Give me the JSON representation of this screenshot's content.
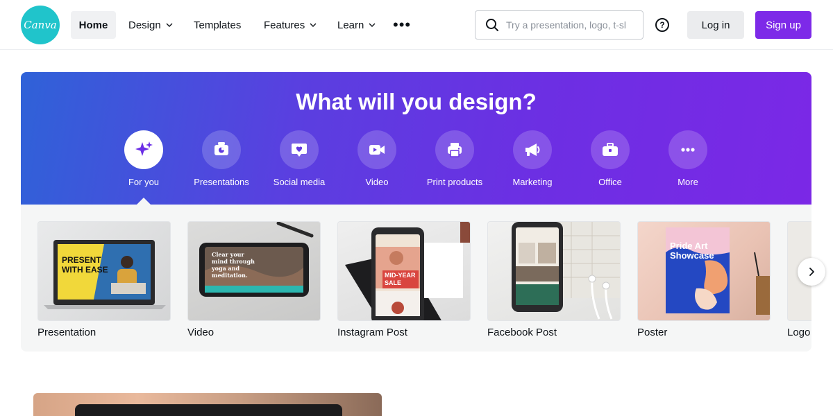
{
  "app": {
    "logo_text": "Canva",
    "brand_color": "#7d2ae8",
    "logo_color": "#20c4cb"
  },
  "nav": {
    "items": [
      {
        "label": "Home",
        "has_dropdown": false,
        "active": true
      },
      {
        "label": "Design",
        "has_dropdown": true
      },
      {
        "label": "Templates",
        "has_dropdown": false
      },
      {
        "label": "Features",
        "has_dropdown": true
      },
      {
        "label": "Learn",
        "has_dropdown": true
      }
    ],
    "more_icon": "more-horizontal-icon"
  },
  "search": {
    "placeholder": "Try a presentation, logo, t-sl",
    "icon": "search-icon"
  },
  "help_icon": "help-circle-icon",
  "auth": {
    "login_label": "Log in",
    "signup_label": "Sign up"
  },
  "hero": {
    "title": "What will you design?",
    "categories": [
      {
        "label": "For you",
        "icon": "sparkle-icon",
        "active": true
      },
      {
        "label": "Presentations",
        "icon": "presentation-icon"
      },
      {
        "label": "Social media",
        "icon": "heart-chat-icon"
      },
      {
        "label": "Video",
        "icon": "video-camera-icon"
      },
      {
        "label": "Print products",
        "icon": "printer-icon"
      },
      {
        "label": "Marketing",
        "icon": "megaphone-icon"
      },
      {
        "label": "Office",
        "icon": "briefcase-icon"
      },
      {
        "label": "More",
        "icon": "more-horizontal-icon"
      }
    ]
  },
  "templates": {
    "cards": [
      {
        "title": "Presentation",
        "thumb_text": "PRESENT WITH EASE"
      },
      {
        "title": "Video",
        "thumb_text": "Clear your mind through yoga and meditation."
      },
      {
        "title": "Instagram Post",
        "thumb_text": "MID-YEAR SALE"
      },
      {
        "title": "Facebook Post",
        "thumb_text": ""
      },
      {
        "title": "Poster",
        "thumb_text": "Pride Art Showcase"
      },
      {
        "title": "Logo",
        "thumb_text": ""
      }
    ],
    "next_icon": "chevron-right-icon"
  }
}
